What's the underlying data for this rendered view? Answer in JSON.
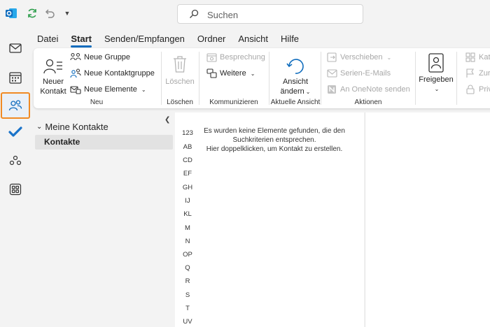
{
  "search": {
    "placeholder": "Suchen"
  },
  "menu": {
    "tabs": [
      {
        "label": "Datei",
        "active": false
      },
      {
        "label": "Start",
        "active": true
      },
      {
        "label": "Senden/Empfangen",
        "active": false
      },
      {
        "label": "Ordner",
        "active": false
      },
      {
        "label": "Ansicht",
        "active": false
      },
      {
        "label": "Hilfe",
        "active": false
      }
    ]
  },
  "ribbon": {
    "neu": {
      "label": "Neu",
      "neuer_kontakt_1": "Neuer",
      "neuer_kontakt_2": "Kontakt",
      "neue_gruppe": "Neue Gruppe",
      "neue_kontaktgruppe": "Neue Kontaktgruppe",
      "neue_elemente": "Neue Elemente"
    },
    "loeschen": {
      "label": "Löschen",
      "button": "Löschen"
    },
    "kommunizieren": {
      "label": "Kommunizieren",
      "besprechung": "Besprechung",
      "weitere": "Weitere"
    },
    "aktuelle_ansicht": {
      "label": "Aktuelle Ansicht",
      "ansicht_1": "Ansicht",
      "ansicht_2": "ändern"
    },
    "aktionen": {
      "label": "Aktionen",
      "verschieben": "Verschieben",
      "serien_emails": "Serien-E-Mails",
      "onenote": "An OneNote senden"
    },
    "freigeben": {
      "button": "Freigeben"
    },
    "partial": {
      "kate": "Kate",
      "zur": "Zur",
      "priv": "Priv"
    }
  },
  "folders": {
    "group": "Meine Kontakte",
    "items": [
      "Kontakte"
    ]
  },
  "alphabet": [
    "123",
    "AB",
    "CD",
    "EF",
    "GH",
    "IJ",
    "KL",
    "M",
    "N",
    "OP",
    "Q",
    "R",
    "S",
    "T",
    "UV"
  ],
  "list": {
    "empty_line1": "Es wurden keine Elemente gefunden, die den",
    "empty_line2": "Suchkriterien entsprechen.",
    "empty_line3": "Hier doppelklicken, um Kontakt zu erstellen."
  },
  "colors": {
    "accent": "#0f6cbd",
    "active_rail_border": "#f08a24",
    "todo_check": "#1a73c9"
  }
}
